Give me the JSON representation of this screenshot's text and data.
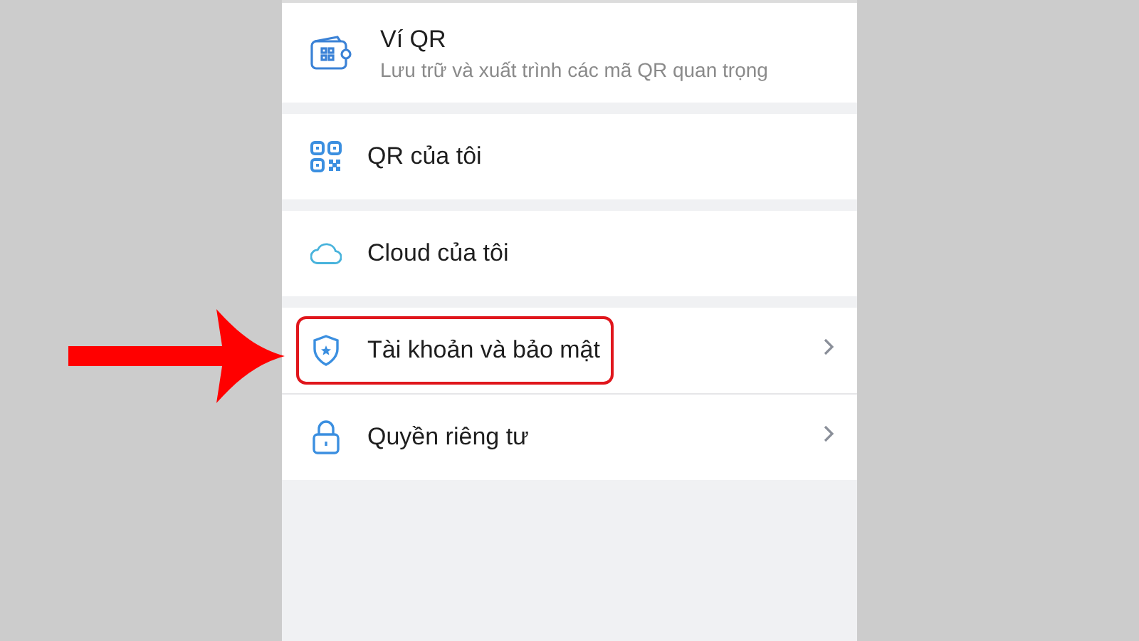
{
  "groups": [
    {
      "items": [
        {
          "kind": "wallet",
          "title": "Ví QR",
          "subtitle": "Lưu trữ và xuất trình các mã QR quan trọng",
          "chevron": false,
          "highlighted": false
        }
      ]
    },
    {
      "items": [
        {
          "kind": "qr",
          "title": "QR của tôi",
          "chevron": false,
          "highlighted": false
        }
      ]
    },
    {
      "items": [
        {
          "kind": "cloud",
          "title": "Cloud của tôi",
          "chevron": false,
          "highlighted": false
        }
      ]
    },
    {
      "items": [
        {
          "kind": "shield",
          "title": "Tài khoản và bảo mật",
          "chevron": true,
          "highlighted": true
        },
        {
          "kind": "lock",
          "title": "Quyền riêng tư",
          "chevron": true,
          "highlighted": false
        }
      ]
    }
  ]
}
